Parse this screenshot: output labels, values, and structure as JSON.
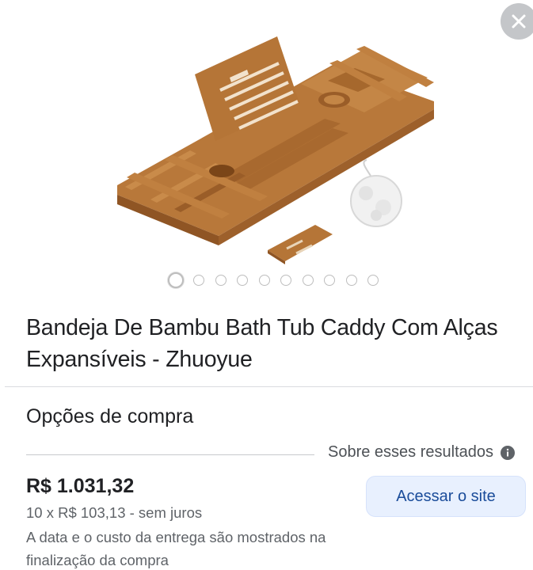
{
  "product": {
    "title": "Bandeja De Bambu Bath Tub Caddy Com Alças Expansíveis - Zhuoyue",
    "image_icon": "bamboo-bath-caddy-image",
    "carousel": {
      "count": 10,
      "active_index": 0
    }
  },
  "purchase": {
    "section_title": "Opções de compra",
    "about_results": "Sobre esses resultados",
    "price": "R$ 1.031,32",
    "installments": "10 x R$ 103,13 - sem juros",
    "delivery_note": "A data e o custo da entrega são mostrados na finalização da compra",
    "visit_button": "Acessar o site"
  },
  "colors": {
    "button_bg": "#e8f0fe",
    "button_text": "#1a4c9a",
    "bamboo": "#b06f30"
  }
}
